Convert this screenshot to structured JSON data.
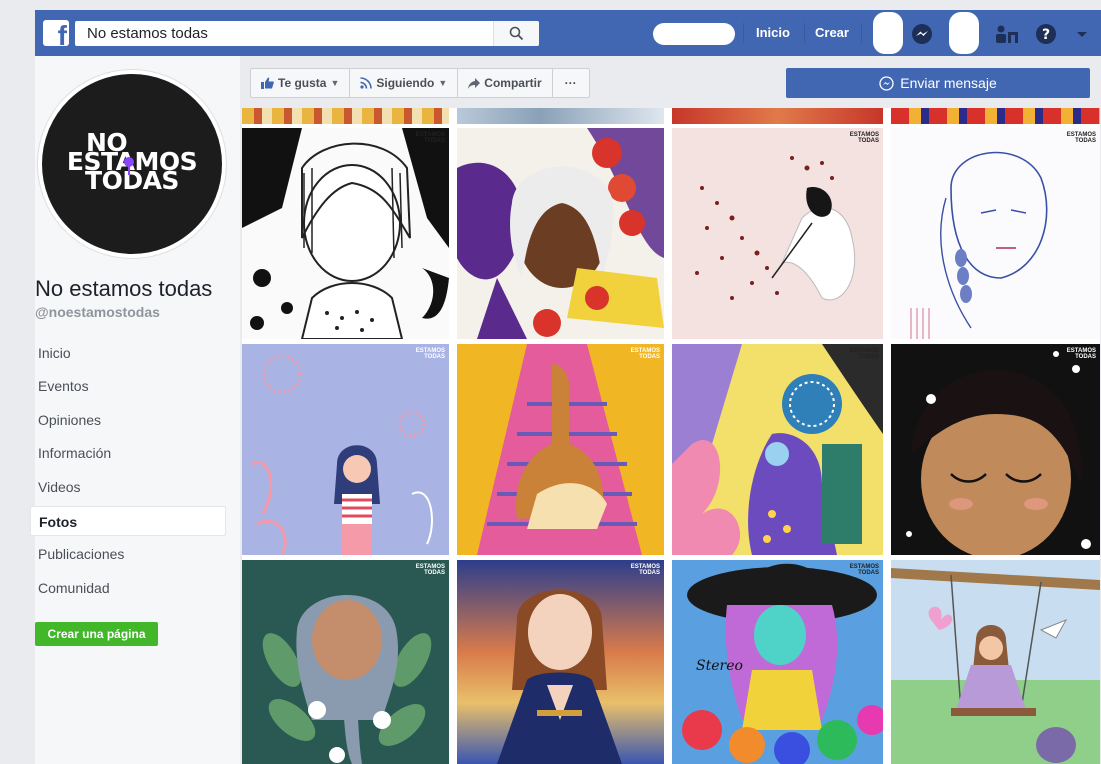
{
  "topbar": {
    "search_value": "No estamos todas",
    "nav_home": "Inicio",
    "nav_create": "Crear",
    "icons": [
      "facebook-logo-icon",
      "search-icon",
      "messenger-icon",
      "friend-requests-icon",
      "help-icon",
      "chevron-down-icon"
    ]
  },
  "colors": {
    "brand": "#4267b2",
    "page_bg": "#e9ebee",
    "create_green": "#42b72a",
    "logo_accent": "#8b45ff"
  },
  "page": {
    "logo_line1": "NO",
    "logo_line2": "ESTAMOS",
    "logo_line3": "TODAS",
    "name": "No estamos todas",
    "handle": "@noestamostodas"
  },
  "sidebar": {
    "items": [
      {
        "label": "Inicio"
      },
      {
        "label": "Eventos"
      },
      {
        "label": "Opiniones"
      },
      {
        "label": "Información"
      },
      {
        "label": "Videos"
      },
      {
        "label": "Fotos",
        "active": true
      },
      {
        "label": "Publicaciones"
      },
      {
        "label": "Comunidad"
      }
    ],
    "create_page": "Crear una página"
  },
  "actions": {
    "like": "Te gusta",
    "following": "Siguiendo",
    "share": "Compartir",
    "more": "···",
    "message": "Enviar mensaje"
  },
  "photos": {
    "watermark_line1": "ESTAMOS",
    "watermark_line2": "TODAS",
    "signature": "Stereo"
  }
}
